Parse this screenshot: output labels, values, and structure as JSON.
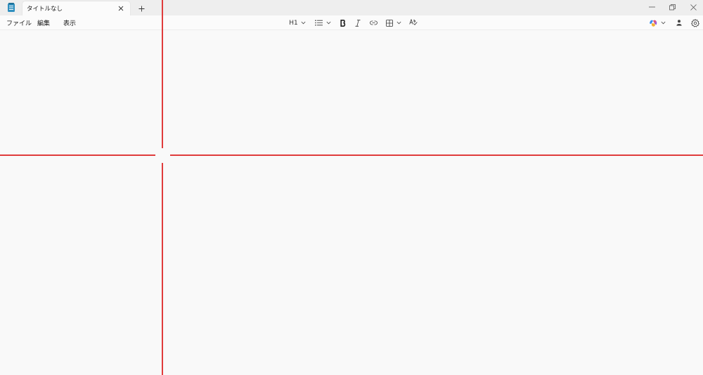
{
  "tab": {
    "title": "タイトルなし"
  },
  "menu": {
    "items": [
      {
        "label": "ファイル"
      },
      {
        "label": "編集"
      },
      {
        "label": "表示"
      }
    ]
  },
  "toolbar": {
    "heading_label": "H1",
    "icons": [
      "heading-dropdown-icon",
      "list-icon",
      "bold-icon",
      "italic-icon",
      "link-icon",
      "table-icon",
      "spellcheck-icon"
    ]
  },
  "right_tools": {
    "icons": [
      "copilot-icon",
      "account-icon",
      "settings-icon"
    ]
  },
  "window_controls": {
    "icons": [
      "minimize-icon",
      "restore-icon",
      "close-icon"
    ]
  },
  "colors": {
    "crosshair": "#e03c3c",
    "background": "#f9f9f9",
    "tabstrip": "#eeeeee"
  }
}
